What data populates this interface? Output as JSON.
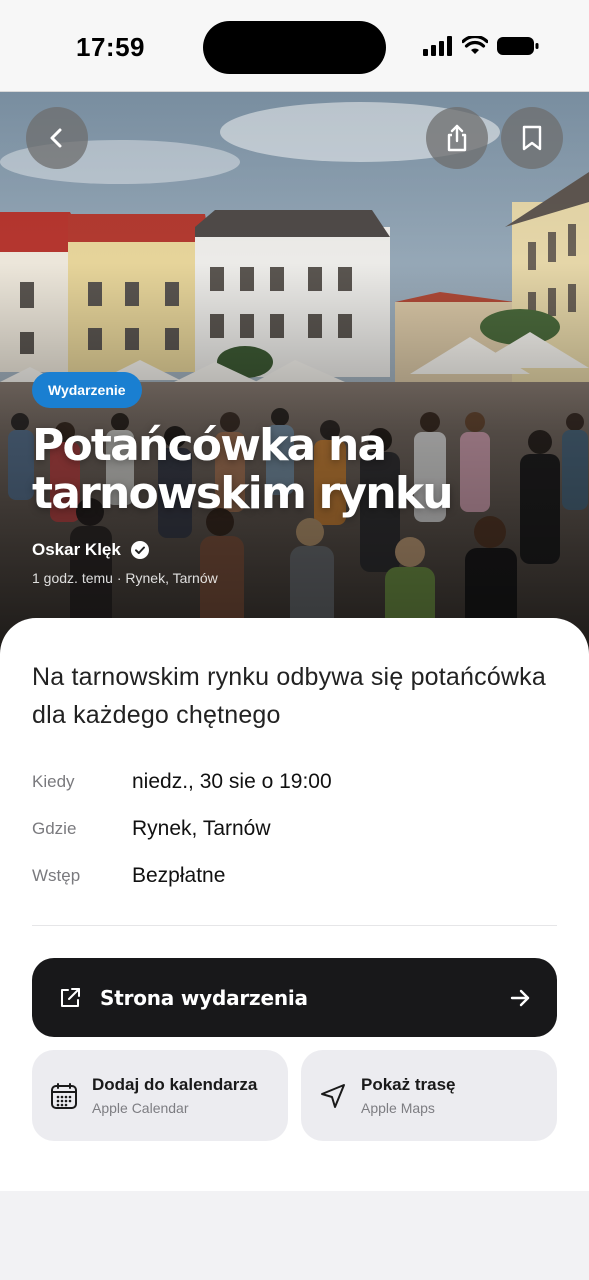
{
  "status_bar": {
    "time": "17:59"
  },
  "hero": {
    "badge": "Wydarzenie",
    "title": "Potańcówka na tarnowskim rynku",
    "author": "Oskar Klęk",
    "time_ago": "1 godz. temu",
    "separator": "·",
    "location": "Rynek, Tarnów"
  },
  "summary": "Na tarnowskim rynku odbywa się potańcówka dla każdego chętnego",
  "details": [
    {
      "label": "Kiedy",
      "value": "niedz., 30 sie o 19:00"
    },
    {
      "label": "Gdzie",
      "value": "Rynek, Tarnów"
    },
    {
      "label": "Wstęp",
      "value": "Bezpłatne"
    }
  ],
  "actions": {
    "event_page": "Strona wydarzenia",
    "calendar_title": "Dodaj do kalendarza",
    "calendar_sub": "Apple Calendar",
    "route_title": "Pokaż trasę",
    "route_sub": "Apple Maps"
  },
  "colors": {
    "badge": "#1a7fd1",
    "primary_button": "#18181a",
    "secondary_button": "#ececf0"
  }
}
